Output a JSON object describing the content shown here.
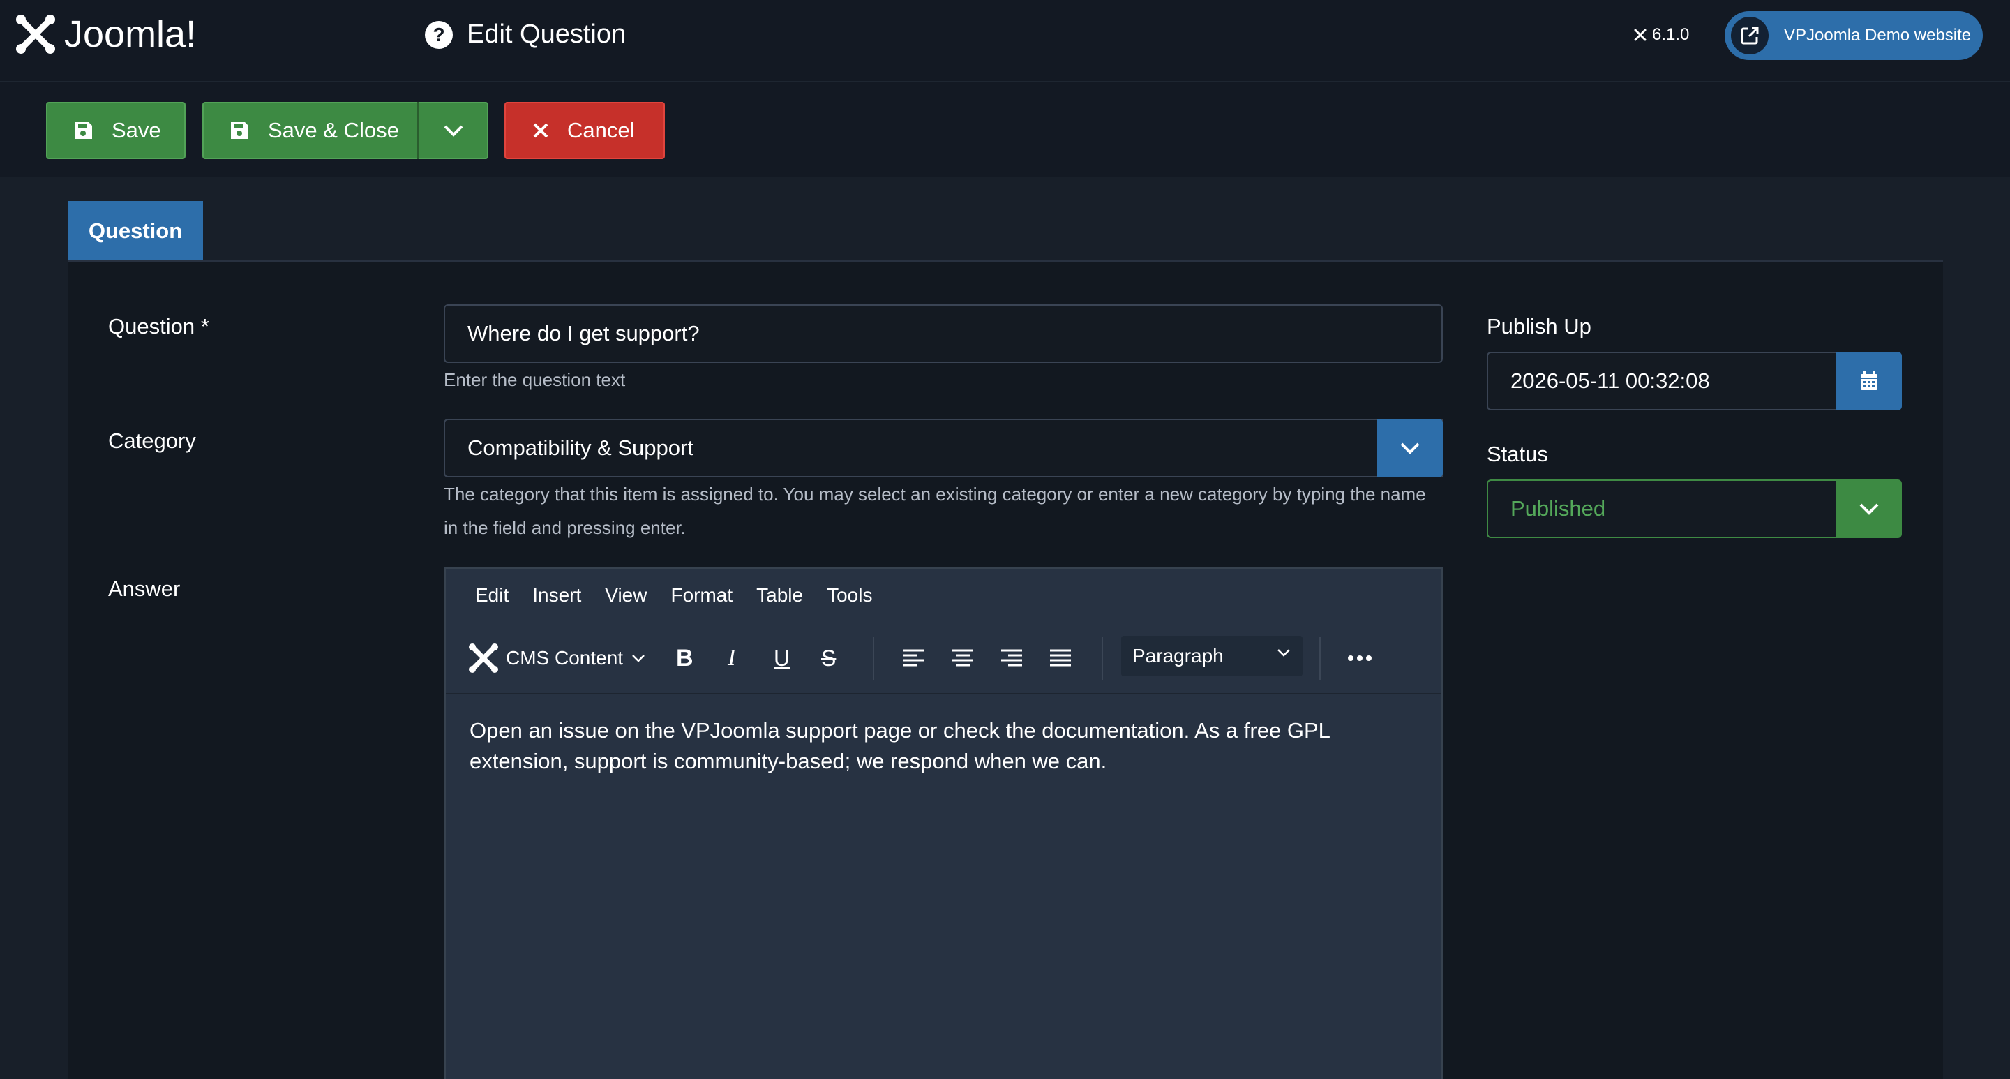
{
  "header": {
    "brand": "Joomla!",
    "page_title": "Edit Question",
    "version": "6.1.0",
    "site_link": "VPJoomla Demo website"
  },
  "toolbar": {
    "save_label": "Save",
    "save_close_label": "Save & Close",
    "cancel_label": "Cancel"
  },
  "tabs": [
    {
      "label": "Question",
      "active": true
    }
  ],
  "form": {
    "question": {
      "label": "Question *",
      "value": "Where do I get support?",
      "hint": "Enter the question text"
    },
    "category": {
      "label": "Category",
      "value": "Compatibility & Support",
      "hint": "The category that this item is assigned to. You may select an existing category or enter a new category by typing the name in the field and pressing enter."
    },
    "answer": {
      "label": "Answer"
    },
    "publish_up": {
      "label": "Publish Up",
      "value": "2026-05-11 00:32:08"
    },
    "status": {
      "label": "Status",
      "value": "Published"
    }
  },
  "editor": {
    "menu": [
      "Edit",
      "Insert",
      "View",
      "Format",
      "Table",
      "Tools"
    ],
    "cms_content": "CMS Content",
    "bold": "B",
    "italic": "I",
    "underline": "U",
    "strike": "S",
    "format_select": "Paragraph",
    "content": "Open an issue on the VPJoomla support page or check the documentation. As a free GPL extension, support is community-based; we respond when we can."
  },
  "colors": {
    "primary": "#2d6eaa",
    "success": "#3d8a43",
    "danger": "#c6302a",
    "status_text": "#54a85a"
  }
}
